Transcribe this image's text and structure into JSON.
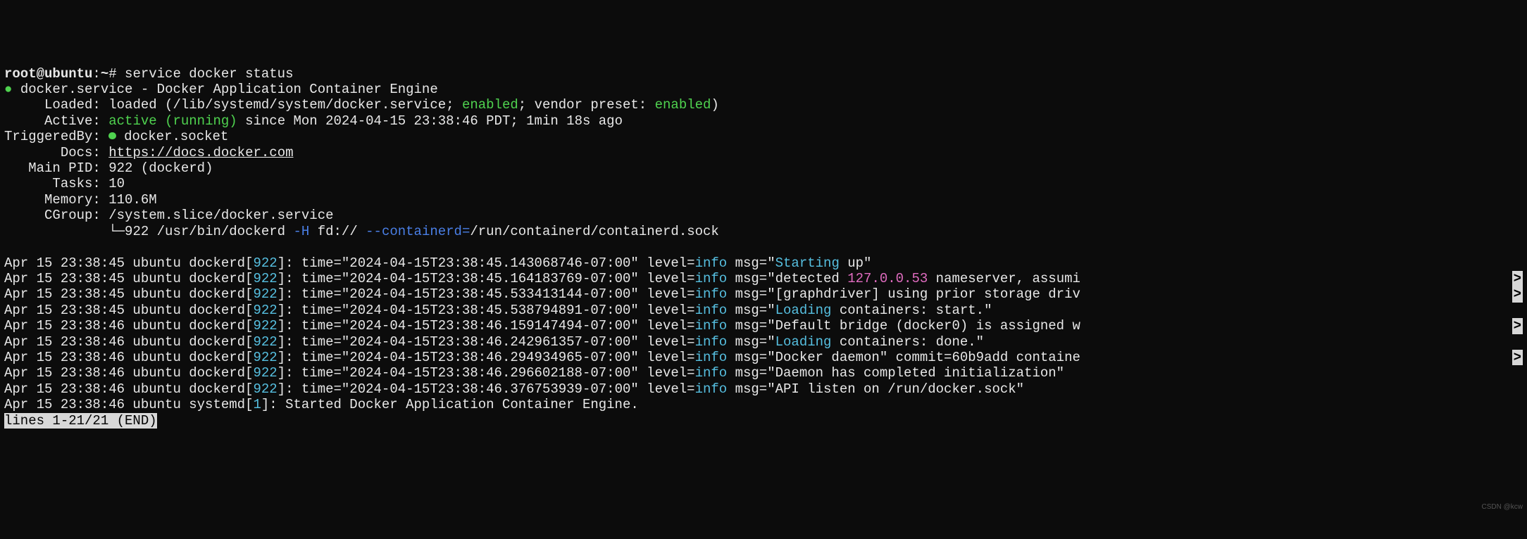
{
  "prompt": {
    "user": "root@ubuntu",
    "path": "~",
    "symbol": "#",
    "command": "service docker status"
  },
  "header": {
    "bullet": "●",
    "service": "docker.service",
    "dash": " - ",
    "desc": "Docker Application Container Engine",
    "loaded": {
      "label": "Loaded:",
      "value": " loaded (/lib/systemd/system/docker.service; ",
      "enabled": "enabled",
      "middle": "; vendor preset: ",
      "preset": "enabled",
      "end": ")"
    },
    "active": {
      "label": "Active:",
      "value": "active (running)",
      "since": " since Mon 2024-04-15 23:38:46 PDT; 1min 18s ago"
    },
    "triggered": {
      "label": "TriggeredBy:",
      "bullet": "●",
      "value": " docker.socket"
    },
    "docs": {
      "label": "Docs:",
      "url": "https://docs.docker.com"
    },
    "mainpid": {
      "label": "Main PID:",
      "value": " 922 (dockerd)"
    },
    "tasks": {
      "label": "Tasks:",
      "value": " 10"
    },
    "memory": {
      "label": "Memory:",
      "value": " 110.6M"
    },
    "cgroup": {
      "label": "CGroup:",
      "value": " /system.slice/docker.service"
    },
    "tree": {
      "branch": "└─",
      "pid": "922 ",
      "cmd": "/usr/bin/dockerd ",
      "flag1": "-H",
      "proto": " fd:// ",
      "flag2": "--containerd=",
      "sock": "/run/containerd/containerd.sock"
    }
  },
  "logs": [
    {
      "ts": "Apr 15 23:38:45 ubuntu dockerd",
      "pid": "922",
      "time": "2024-04-15T23:38:45.143068746-07:00",
      "level": "info",
      "msg_pre": " msg=\"",
      "msg_hl": "Starting",
      "msg_post": " up\"",
      "trunc": false
    },
    {
      "ts": "Apr 15 23:38:45 ubuntu dockerd",
      "pid": "922",
      "time": "2024-04-15T23:38:45.164183769-07:00",
      "level": "info",
      "msg_pre": " msg=\"detected ",
      "msg_hl": "127.0.0.53",
      "msg_post": " nameserver, assumi",
      "trunc": true,
      "hl_class": "pink"
    },
    {
      "ts": "Apr 15 23:38:45 ubuntu dockerd",
      "pid": "922",
      "time": "2024-04-15T23:38:45.533413144-07:00",
      "level": "info",
      "msg_pre": " msg=\"[graphdriver] using prior storage driv",
      "msg_hl": "",
      "msg_post": "",
      "trunc": true
    },
    {
      "ts": "Apr 15 23:38:45 ubuntu dockerd",
      "pid": "922",
      "time": "2024-04-15T23:38:45.538794891-07:00",
      "level": "info",
      "msg_pre": " msg=\"",
      "msg_hl": "Loading",
      "msg_post": " containers: start.\"",
      "trunc": false
    },
    {
      "ts": "Apr 15 23:38:46 ubuntu dockerd",
      "pid": "922",
      "time": "2024-04-15T23:38:46.159147494-07:00",
      "level": "info",
      "msg_pre": " msg=\"Default bridge (docker0) is assigned w",
      "msg_hl": "",
      "msg_post": "",
      "trunc": true
    },
    {
      "ts": "Apr 15 23:38:46 ubuntu dockerd",
      "pid": "922",
      "time": "2024-04-15T23:38:46.242961357-07:00",
      "level": "info",
      "msg_pre": " msg=\"",
      "msg_hl": "Loading",
      "msg_post": " containers: done.\"",
      "trunc": false
    },
    {
      "ts": "Apr 15 23:38:46 ubuntu dockerd",
      "pid": "922",
      "time": "2024-04-15T23:38:46.294934965-07:00",
      "level": "info",
      "msg_pre": " msg=\"Docker daemon\" commit=60b9add containe",
      "msg_hl": "",
      "msg_post": "",
      "trunc": true
    },
    {
      "ts": "Apr 15 23:38:46 ubuntu dockerd",
      "pid": "922",
      "time": "2024-04-15T23:38:46.296602188-07:00",
      "level": "info",
      "msg_pre": " msg=\"Daemon has completed initialization\"",
      "msg_hl": "",
      "msg_post": "",
      "trunc": false
    },
    {
      "ts": "Apr 15 23:38:46 ubuntu dockerd",
      "pid": "922",
      "time": "2024-04-15T23:38:46.376753939-07:00",
      "level": "info",
      "msg_pre": " msg=\"API listen on /run/docker.sock\"",
      "msg_hl": "",
      "msg_post": "",
      "trunc": false
    }
  ],
  "systemd_line": {
    "ts": "Apr 15 23:38:46 ubuntu systemd",
    "pid": "1",
    "text": ": Started Docker Application Container Engine."
  },
  "pager": "lines 1-21/21 (END)",
  "watermark": "CSDN @kcw"
}
